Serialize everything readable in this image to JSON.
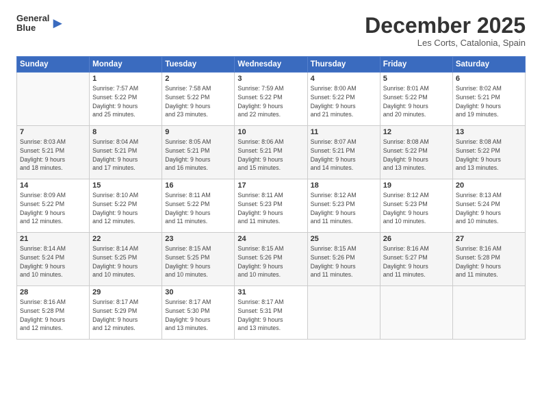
{
  "header": {
    "logo_line1": "General",
    "logo_line2": "Blue",
    "month": "December 2025",
    "location": "Les Corts, Catalonia, Spain"
  },
  "weekdays": [
    "Sunday",
    "Monday",
    "Tuesday",
    "Wednesday",
    "Thursday",
    "Friday",
    "Saturday"
  ],
  "weeks": [
    [
      {
        "day": "",
        "info": ""
      },
      {
        "day": "1",
        "info": "Sunrise: 7:57 AM\nSunset: 5:22 PM\nDaylight: 9 hours\nand 25 minutes."
      },
      {
        "day": "2",
        "info": "Sunrise: 7:58 AM\nSunset: 5:22 PM\nDaylight: 9 hours\nand 23 minutes."
      },
      {
        "day": "3",
        "info": "Sunrise: 7:59 AM\nSunset: 5:22 PM\nDaylight: 9 hours\nand 22 minutes."
      },
      {
        "day": "4",
        "info": "Sunrise: 8:00 AM\nSunset: 5:22 PM\nDaylight: 9 hours\nand 21 minutes."
      },
      {
        "day": "5",
        "info": "Sunrise: 8:01 AM\nSunset: 5:22 PM\nDaylight: 9 hours\nand 20 minutes."
      },
      {
        "day": "6",
        "info": "Sunrise: 8:02 AM\nSunset: 5:21 PM\nDaylight: 9 hours\nand 19 minutes."
      }
    ],
    [
      {
        "day": "7",
        "info": "Sunrise: 8:03 AM\nSunset: 5:21 PM\nDaylight: 9 hours\nand 18 minutes."
      },
      {
        "day": "8",
        "info": "Sunrise: 8:04 AM\nSunset: 5:21 PM\nDaylight: 9 hours\nand 17 minutes."
      },
      {
        "day": "9",
        "info": "Sunrise: 8:05 AM\nSunset: 5:21 PM\nDaylight: 9 hours\nand 16 minutes."
      },
      {
        "day": "10",
        "info": "Sunrise: 8:06 AM\nSunset: 5:21 PM\nDaylight: 9 hours\nand 15 minutes."
      },
      {
        "day": "11",
        "info": "Sunrise: 8:07 AM\nSunset: 5:21 PM\nDaylight: 9 hours\nand 14 minutes."
      },
      {
        "day": "12",
        "info": "Sunrise: 8:08 AM\nSunset: 5:22 PM\nDaylight: 9 hours\nand 13 minutes."
      },
      {
        "day": "13",
        "info": "Sunrise: 8:08 AM\nSunset: 5:22 PM\nDaylight: 9 hours\nand 13 minutes."
      }
    ],
    [
      {
        "day": "14",
        "info": "Sunrise: 8:09 AM\nSunset: 5:22 PM\nDaylight: 9 hours\nand 12 minutes."
      },
      {
        "day": "15",
        "info": "Sunrise: 8:10 AM\nSunset: 5:22 PM\nDaylight: 9 hours\nand 12 minutes."
      },
      {
        "day": "16",
        "info": "Sunrise: 8:11 AM\nSunset: 5:22 PM\nDaylight: 9 hours\nand 11 minutes."
      },
      {
        "day": "17",
        "info": "Sunrise: 8:11 AM\nSunset: 5:23 PM\nDaylight: 9 hours\nand 11 minutes."
      },
      {
        "day": "18",
        "info": "Sunrise: 8:12 AM\nSunset: 5:23 PM\nDaylight: 9 hours\nand 11 minutes."
      },
      {
        "day": "19",
        "info": "Sunrise: 8:12 AM\nSunset: 5:23 PM\nDaylight: 9 hours\nand 10 minutes."
      },
      {
        "day": "20",
        "info": "Sunrise: 8:13 AM\nSunset: 5:24 PM\nDaylight: 9 hours\nand 10 minutes."
      }
    ],
    [
      {
        "day": "21",
        "info": "Sunrise: 8:14 AM\nSunset: 5:24 PM\nDaylight: 9 hours\nand 10 minutes."
      },
      {
        "day": "22",
        "info": "Sunrise: 8:14 AM\nSunset: 5:25 PM\nDaylight: 9 hours\nand 10 minutes."
      },
      {
        "day": "23",
        "info": "Sunrise: 8:15 AM\nSunset: 5:25 PM\nDaylight: 9 hours\nand 10 minutes."
      },
      {
        "day": "24",
        "info": "Sunrise: 8:15 AM\nSunset: 5:26 PM\nDaylight: 9 hours\nand 10 minutes."
      },
      {
        "day": "25",
        "info": "Sunrise: 8:15 AM\nSunset: 5:26 PM\nDaylight: 9 hours\nand 11 minutes."
      },
      {
        "day": "26",
        "info": "Sunrise: 8:16 AM\nSunset: 5:27 PM\nDaylight: 9 hours\nand 11 minutes."
      },
      {
        "day": "27",
        "info": "Sunrise: 8:16 AM\nSunset: 5:28 PM\nDaylight: 9 hours\nand 11 minutes."
      }
    ],
    [
      {
        "day": "28",
        "info": "Sunrise: 8:16 AM\nSunset: 5:28 PM\nDaylight: 9 hours\nand 12 minutes."
      },
      {
        "day": "29",
        "info": "Sunrise: 8:17 AM\nSunset: 5:29 PM\nDaylight: 9 hours\nand 12 minutes."
      },
      {
        "day": "30",
        "info": "Sunrise: 8:17 AM\nSunset: 5:30 PM\nDaylight: 9 hours\nand 13 minutes."
      },
      {
        "day": "31",
        "info": "Sunrise: 8:17 AM\nSunset: 5:31 PM\nDaylight: 9 hours\nand 13 minutes."
      },
      {
        "day": "",
        "info": ""
      },
      {
        "day": "",
        "info": ""
      },
      {
        "day": "",
        "info": ""
      }
    ]
  ]
}
